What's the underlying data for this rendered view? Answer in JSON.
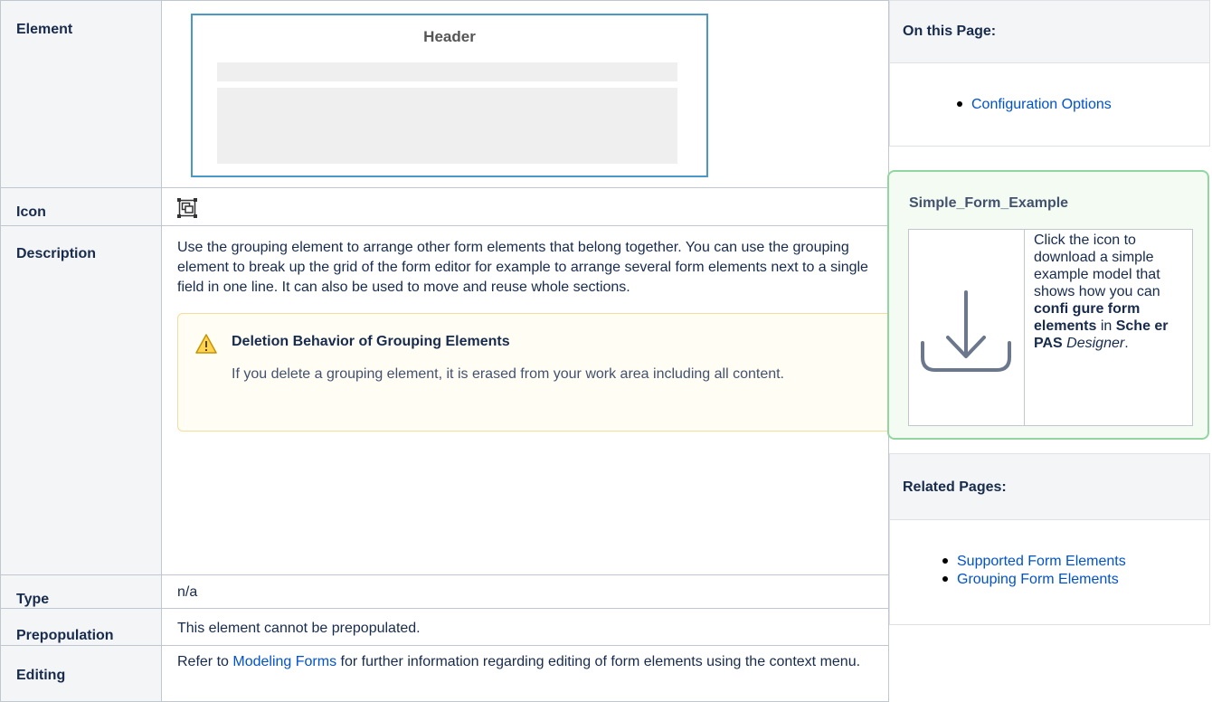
{
  "table": {
    "rows": {
      "element": {
        "label": "Element"
      },
      "icon": {
        "label": "Icon",
        "icon_name": "grouping-element-icon"
      },
      "description": {
        "label": "Description",
        "text": "Use the grouping element to arrange other form elements that belong together. You can use the grouping element to break up the grid of the form editor for example to arrange several form elements next to a single field in one line. It can also be used to move and reuse whole sections."
      },
      "type": {
        "label": "Type",
        "value": "n/a"
      },
      "prepopulation": {
        "label": "Prepopulation",
        "value": "This element cannot be prepopulated."
      },
      "editing": {
        "label": "Editing",
        "prefix": "Refer to ",
        "link": "Modeling Forms",
        "suffix": " for further information regarding editing of form elements using the context menu."
      }
    },
    "mockup": {
      "title": "Header"
    }
  },
  "warning": {
    "icon_name": "warning-triangle-icon",
    "title": "Deletion Behavior of Grouping Elements",
    "body": "If you delete a grouping element, it is erased from your work area including all content."
  },
  "sidebar": {
    "on_this_page": {
      "title": "On this Page:",
      "links": [
        "Configuration Options"
      ]
    },
    "example": {
      "title": "Simple_Form_Example",
      "download_icon": "download-icon",
      "text_parts": {
        "t1": "Click the icon to download a simple example model that shows how you can ",
        "b1": "confi gure form elements",
        "t2": " in ",
        "b2": "Sche er PAS",
        "t3": " ",
        "i1": "Designer",
        "t4": "."
      }
    },
    "related_pages": {
      "title": "Related Pages:",
      "links": [
        "Supported Form Elements",
        "Grouping Form Elements"
      ]
    }
  },
  "colors": {
    "link": "#0052cc",
    "header_bg": "#f4f5f7",
    "border": "#c1c7d0",
    "warning_bg": "#fffdf4",
    "warning_border": "#f2dd9a",
    "warning_icon": "#d4a000",
    "example_bg": "#f3fbf3",
    "example_border": "#91d6a0",
    "mockup_border": "#4a98c9"
  }
}
